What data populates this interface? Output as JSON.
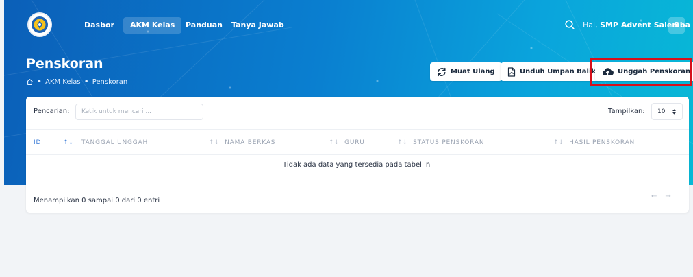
{
  "nav": {
    "items": [
      {
        "label": "Dasbor",
        "active": false
      },
      {
        "label": "AKM Kelas",
        "active": true
      },
      {
        "label": "Panduan",
        "active": false
      },
      {
        "label": "Tanya Jawab",
        "active": false
      }
    ],
    "greeting_prefix": "Hai, ",
    "user_name": "SMP Advent Salemba",
    "avatar_initial": "S",
    "icons": {
      "logo": "tut-wuri-handayani-logo",
      "search": "search-icon"
    }
  },
  "header": {
    "title": "Penskoran",
    "breadcrumb": [
      "AKM Kelas",
      "Penskoran"
    ],
    "breadcrumb_sep": "•",
    "buttons": {
      "reload": "Muat Ulang",
      "download_feedback": "Unduh Umpan Balik",
      "upload_scoring": "Unggah Penskoran"
    }
  },
  "table": {
    "search_label": "Pencarian:",
    "search_placeholder": "Ketik untuk mencari ...",
    "show_label": "Tampilkan:",
    "show_value": "10",
    "columns": [
      "ID",
      "TANGGAL UNGGAH",
      "NAMA BERKAS",
      "GURU",
      "STATUS PENSKORAN",
      "HASIL PENSKORAN"
    ],
    "sort_glyph": "↑↓",
    "empty_message": "Tidak ada data yang tersedia pada tabel ini",
    "info": "Menampilkan 0 sampai 0 dari 0 entri",
    "pager_prev": "←",
    "pager_next": "→"
  },
  "colors": {
    "hero_start": "#0b5fb8",
    "hero_end": "#08b9d6",
    "highlight": "#d6101b",
    "accent": "#3f7fd8"
  }
}
